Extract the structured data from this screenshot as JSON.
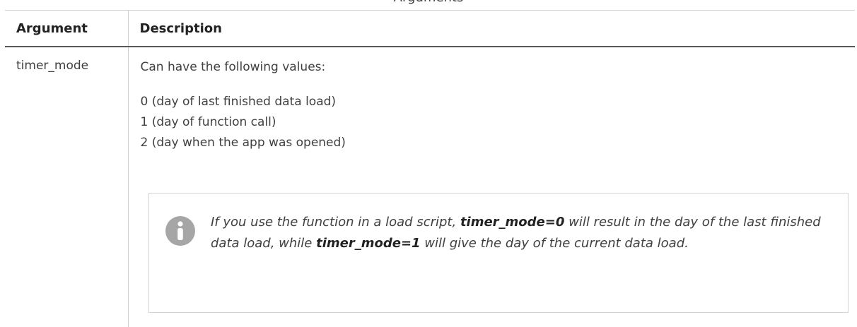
{
  "caption": "Arguments",
  "table": {
    "headers": {
      "argument": "Argument",
      "description": "Description"
    },
    "rows": [
      {
        "argument": "timer_mode",
        "intro": "Can have the following values:",
        "values": [
          "0 (day of last finished data load)",
          "1 (day of function call)",
          "2 (day when the app was opened)"
        ]
      }
    ]
  },
  "note": {
    "icon": "info-icon",
    "segment_1": "If you use the function in a load script, ",
    "bold_1": "timer_mode=0",
    "segment_2": " will result in the day of the last finished data load, while ",
    "bold_2": "timer_mode=1",
    "segment_3": " will give the day of the current data load."
  },
  "colors": {
    "text": "#404040",
    "header_rule": "#595959",
    "border": "#d0d0d0",
    "icon": "#a6a6a6"
  }
}
